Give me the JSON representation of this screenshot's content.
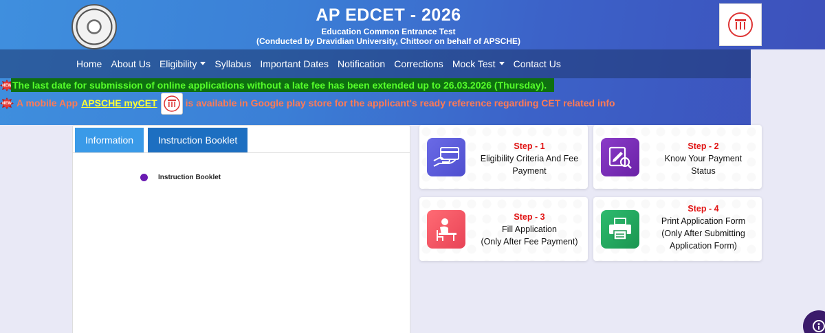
{
  "header": {
    "title": "AP EDCET - 2026",
    "subtitle_line1": "Education Common Entrance Test",
    "subtitle_line2": "(Conducted by Dravidian University, Chittoor on behalf of APSCHE)"
  },
  "nav": {
    "items": [
      {
        "label": "Home",
        "dropdown": false
      },
      {
        "label": "About Us",
        "dropdown": false
      },
      {
        "label": "Eligibility",
        "dropdown": true
      },
      {
        "label": "Syllabus",
        "dropdown": false
      },
      {
        "label": "Important Dates",
        "dropdown": false
      },
      {
        "label": "Notification",
        "dropdown": false
      },
      {
        "label": "Corrections",
        "dropdown": false
      },
      {
        "label": "Mock Test",
        "dropdown": true
      },
      {
        "label": "Contact Us",
        "dropdown": false
      }
    ]
  },
  "announcements": {
    "badge": "NEW",
    "line1": "The last date for submission of online applications without a late fee has been extended up to 26.03.2026 (Thursday).",
    "line2_prefix": "A mobile App",
    "line2_link": "APSCHE myCET",
    "line2_suffix": "is available in Google play store for the applicant's ready reference regarding CET related info"
  },
  "tabs": {
    "information": "Information",
    "instruction_booklet": "Instruction Booklet"
  },
  "booklet_list": {
    "item": "Instruction Booklet"
  },
  "steps": [
    {
      "label": "Step - 1",
      "line1": "Eligibility Criteria And Fee",
      "line2": "Payment",
      "line3": "",
      "icon": "card-payment-icon",
      "color": "#5b5bd6"
    },
    {
      "label": "Step - 2",
      "line1": "Know Your Payment",
      "line2": "Status",
      "line3": "",
      "icon": "document-search-icon",
      "color": "#7a2fb5"
    },
    {
      "label": "Step - 3",
      "line1": "Fill Application",
      "line2": "(Only After Fee Payment)",
      "line3": "",
      "icon": "student-desk-icon",
      "color": "#f0505f"
    },
    {
      "label": "Step - 4",
      "line1": "Print Application Form",
      "line2": "(Only After Submitting",
      "line3": "Application Form)",
      "icon": "printer-icon",
      "color": "#22a55e"
    }
  ]
}
